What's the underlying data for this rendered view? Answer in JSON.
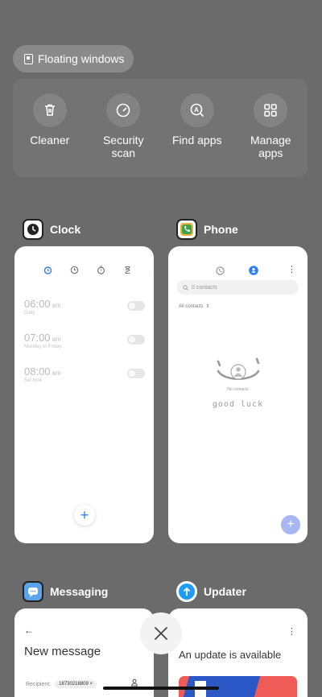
{
  "floating": {
    "label": "Floating windows"
  },
  "tools": [
    {
      "label": "Cleaner",
      "icon": "trash-icon"
    },
    {
      "label": "Security\nscan",
      "icon": "speedometer-icon"
    },
    {
      "label": "Find apps",
      "icon": "find-apps-icon"
    },
    {
      "label": "Manage\napps",
      "icon": "grid-icon"
    }
  ],
  "cards": {
    "clock": {
      "title": "Clock",
      "alarms": [
        {
          "time": "06:00",
          "ampm": "am",
          "repeat": "Daily"
        },
        {
          "time": "07:00",
          "ampm": "am",
          "repeat": "Monday to Friday"
        },
        {
          "time": "08:00",
          "ampm": "am",
          "repeat": "Set time"
        }
      ]
    },
    "phone": {
      "title": "Phone",
      "search_placeholder": "0 contacts",
      "filter": "All contacts",
      "empty_text": "No contacts",
      "doodle_text": "good luck"
    },
    "messaging": {
      "title": "Messaging",
      "header": "New message",
      "recipient_label": "Recipient:",
      "recipient_value": "18730218809"
    },
    "updater": {
      "title": "Updater",
      "headline": "An update is available"
    }
  },
  "colors": {
    "accent": "#2f7df6",
    "background": "#6b6b6b"
  }
}
